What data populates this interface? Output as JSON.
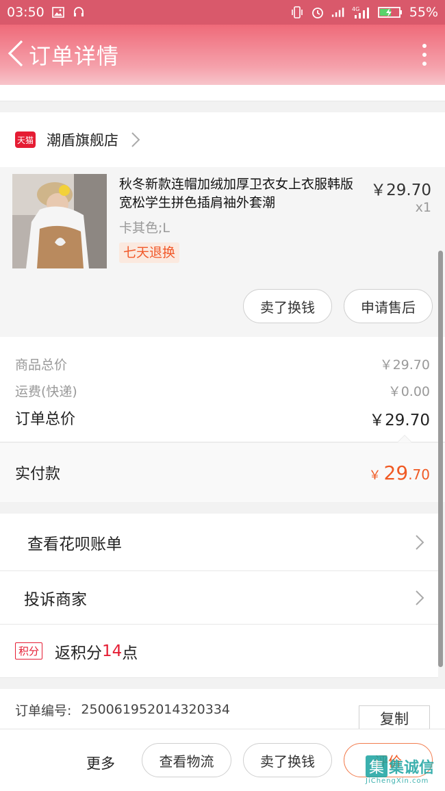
{
  "status_bar": {
    "time": "03:50",
    "battery": "55%",
    "network": "4G"
  },
  "header": {
    "title": "订单详情"
  },
  "shop": {
    "badge": "天猫",
    "name": "潮盾旗舰店"
  },
  "product": {
    "title": "秋冬新款连帽加绒加厚卫衣女上衣服韩版宽松学生拼色插肩袖外套潮",
    "sku": "卡其色;L",
    "tag": "七天退换",
    "price": "￥29.70",
    "quantity": "x1",
    "buttons": {
      "sell": "卖了换钱",
      "after_sale": "申请售后"
    }
  },
  "summary": {
    "goods_label": "商品总价",
    "goods_value": "￥29.70",
    "shipping_label": "运费(快递)",
    "shipping_value": "￥0.00",
    "total_label": "订单总价",
    "total_value": "￥29.70"
  },
  "paid": {
    "label": "实付款",
    "currency": "￥",
    "integer": "29",
    "decimal": ".70"
  },
  "links": {
    "huabei": "查看花呗账单",
    "complain": "投诉商家"
  },
  "points": {
    "badge": "积分",
    "prefix": "返积分",
    "number": "14",
    "suffix": "点"
  },
  "order": {
    "label": "订单编号:",
    "number": "250061952014320334",
    "copy": "复制"
  },
  "bottom_bar": {
    "more": "更多",
    "logistics": "查看物流",
    "sell": "卖了换钱",
    "review": "评价"
  },
  "watermark": {
    "main": "集诚信",
    "sub": "JiChengXin.com"
  },
  "colors": {
    "accent": "#f05a24",
    "tmall_red": "#e51c33",
    "header": "#ef6a79"
  }
}
